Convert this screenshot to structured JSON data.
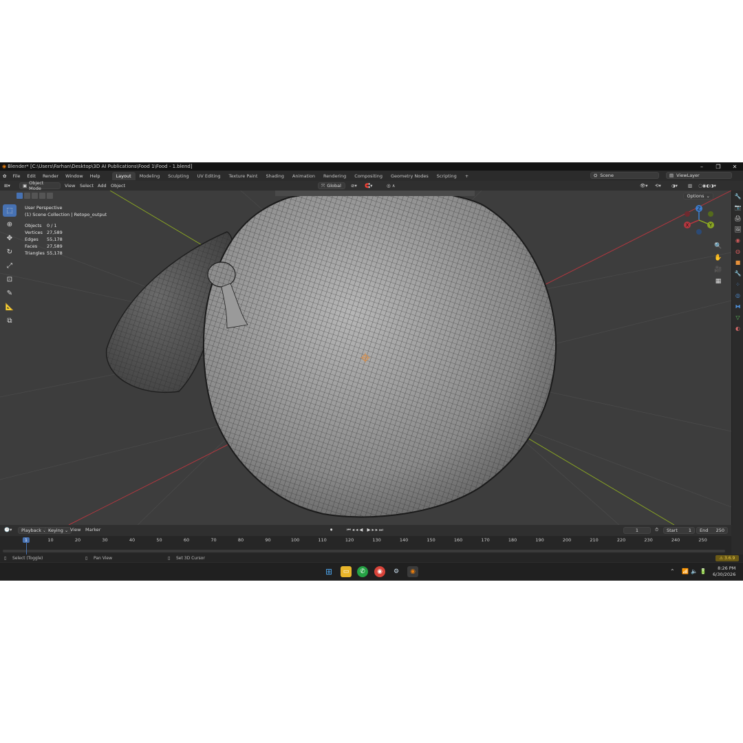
{
  "window": {
    "title": "Blender* [C:\\Users\\Farhan\\Desktop\\3D AI Publications\\Food 1\\Food - 1.blend]",
    "minimize": "–",
    "maximize": "❐",
    "close": "✕"
  },
  "menu": {
    "items": [
      "File",
      "Edit",
      "Render",
      "Window",
      "Help"
    ]
  },
  "workspaces": {
    "tabs": [
      "Layout",
      "Modeling",
      "Sculpting",
      "UV Editing",
      "Texture Paint",
      "Shading",
      "Animation",
      "Rendering",
      "Compositing",
      "Geometry Nodes",
      "Scripting"
    ],
    "active": "Layout",
    "add": "+"
  },
  "scene": {
    "name": "Scene"
  },
  "viewlayer": {
    "name": "ViewLayer"
  },
  "header": {
    "mode": "Object Mode",
    "menus": [
      "View",
      "Select",
      "Add",
      "Object"
    ],
    "orientation": "Global",
    "options": "Options"
  },
  "viewport": {
    "perspective": "User Perspective",
    "collection": "(1) Scene Collection | Retopo_output",
    "stats": [
      {
        "label": "Objects",
        "value": "0 / 1"
      },
      {
        "label": "Vertices",
        "value": "27,589"
      },
      {
        "label": "Edges",
        "value": "55,178"
      },
      {
        "label": "Faces",
        "value": "27,589"
      },
      {
        "label": "Triangles",
        "value": "55,178"
      }
    ],
    "gizmo": {
      "x": "X",
      "y": "Y",
      "z": "Z"
    }
  },
  "timeline": {
    "menus": [
      "Playback",
      "Keying",
      "View",
      "Marker"
    ],
    "current_frame": "1",
    "start_label": "Start",
    "start": "1",
    "end_label": "End",
    "end": "250",
    "ticks": [
      "1",
      "10",
      "20",
      "30",
      "40",
      "50",
      "60",
      "70",
      "80",
      "90",
      "100",
      "110",
      "120",
      "130",
      "140",
      "150",
      "160",
      "170",
      "180",
      "190",
      "200",
      "210",
      "220",
      "230",
      "240",
      "250"
    ]
  },
  "status": {
    "select": "Select (Toggle)",
    "pan": "Pan View",
    "cursor": "Set 3D Cursor",
    "version": "3.6.9"
  },
  "taskbar": {
    "time": "8:26 PM",
    "date": "6/30/2026"
  },
  "colors": {
    "accent": "#4772b3",
    "axis_x": "#b5373f",
    "axis_y": "#8aa623",
    "axis_z": "#3d7ecf",
    "viewport_bg": "#3d3d3d",
    "mesh": "#9a9a9a"
  }
}
